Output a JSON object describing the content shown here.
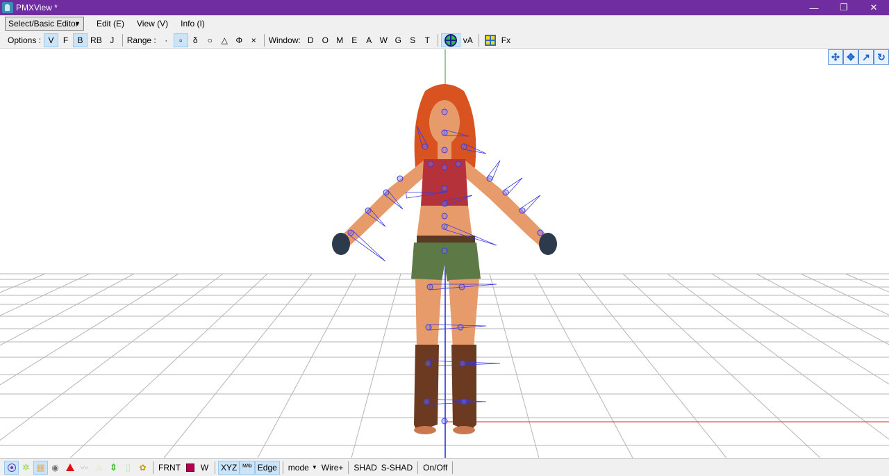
{
  "window": {
    "title": "PMXView *",
    "minimize_glyph": "—",
    "restore_glyph": "❐",
    "close_glyph": "✕"
  },
  "menubar": {
    "editor_select": "Select/Basic Editor",
    "menus": [
      "Edit (E)",
      "View (V)",
      "Info (I)"
    ]
  },
  "toolbar": {
    "options_label": "Options :",
    "options": [
      {
        "label": "V",
        "active": true
      },
      {
        "label": "F",
        "active": false
      },
      {
        "label": "B",
        "active": true
      },
      {
        "label": "RB",
        "active": false
      },
      {
        "label": "J",
        "active": false
      }
    ],
    "range_label": "Range :",
    "range": [
      {
        "label": "·",
        "active": false
      },
      {
        "label": "▫",
        "active": true
      },
      {
        "label": "δ",
        "active": false
      },
      {
        "label": "○",
        "active": false
      },
      {
        "label": "△",
        "active": false
      },
      {
        "label": "Φ",
        "active": false
      },
      {
        "label": "×",
        "active": false
      }
    ],
    "window_label": "Window:",
    "window_buttons": [
      "D",
      "O",
      "M",
      "E",
      "A",
      "W",
      "G",
      "S",
      "T"
    ],
    "va_label": "vA",
    "fx_label": "Fx",
    "icons": [
      "target-icon",
      "grid-icon"
    ]
  },
  "viewport": {
    "nav_controls": [
      "✣",
      "✥",
      "↗",
      "↻"
    ],
    "colors": {
      "grid": "#b5b5b5",
      "x_axis": "#e02020",
      "y_axis": "#20a020",
      "z_axis": "#2020e0",
      "bone": "#3a3ae0"
    }
  },
  "statusbar": {
    "icons": [
      "select-dot-icon",
      "vertex-icon",
      "face-icon",
      "point-icon",
      "triangle-icon",
      "wave-icon",
      "morph-icon",
      "arrow-icon",
      "cylinder-icon",
      "joint-icon"
    ],
    "frnt_label": "FRNT",
    "w_label": "W",
    "xyz_label": "XYZ",
    "mab_label": "ᴹᴬᵇ",
    "edge_label": "Edge",
    "mode_label": "mode",
    "wire_label": "Wire+",
    "shad_label": "SHAD",
    "sshad_label": "S-SHAD",
    "onoff_label": "On/Off"
  }
}
